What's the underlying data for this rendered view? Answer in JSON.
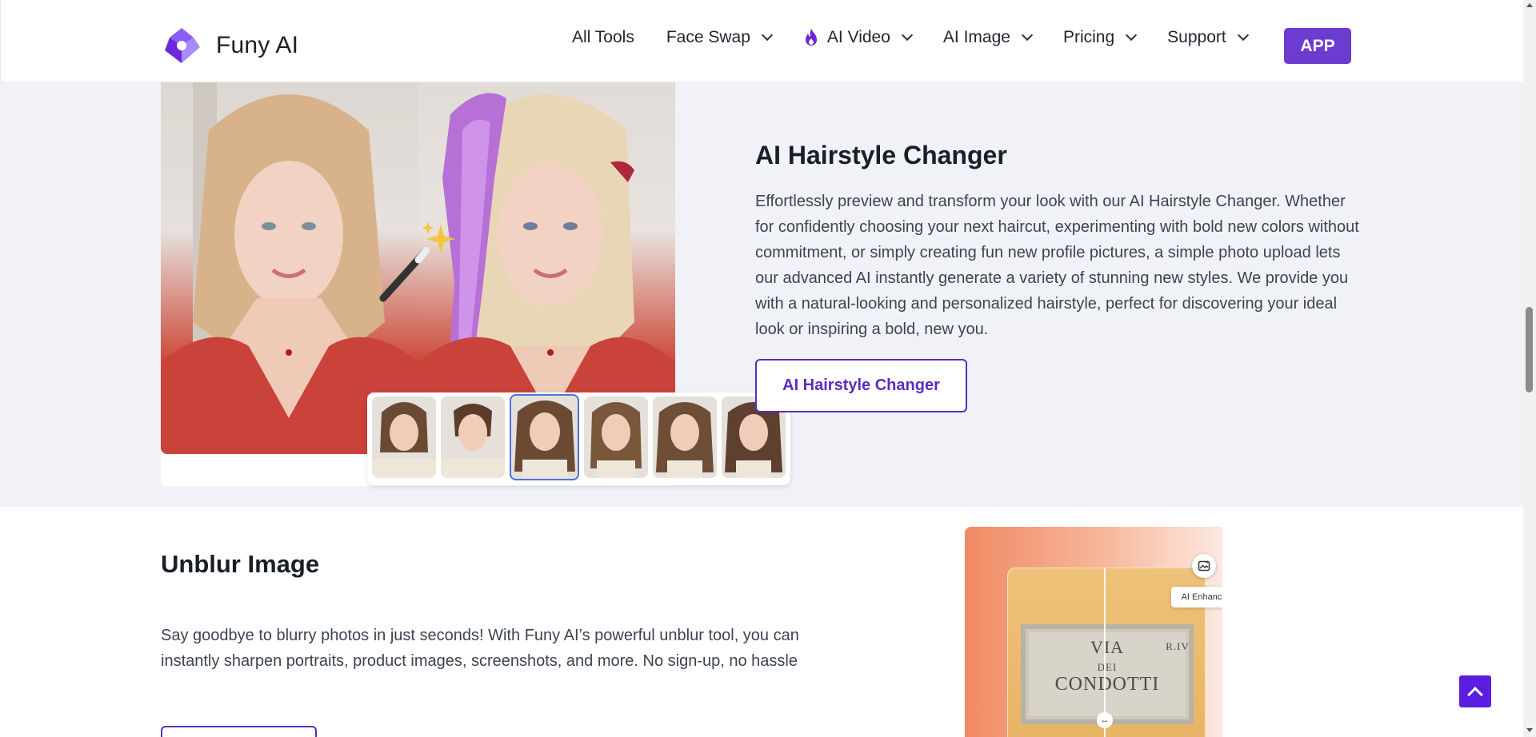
{
  "header": {
    "brand": "Funy AI",
    "nav": [
      {
        "label": "All Tools",
        "dropdown": false
      },
      {
        "label": "Face Swap",
        "dropdown": true
      },
      {
        "label": "AI Video",
        "dropdown": true,
        "icon": "fire-icon"
      },
      {
        "label": "AI Image",
        "dropdown": true
      },
      {
        "label": "Pricing",
        "dropdown": true
      },
      {
        "label": "Support",
        "dropdown": true
      }
    ],
    "app_button": "APP"
  },
  "hairstyle": {
    "title": "AI Hairstyle Changer",
    "description": "Effortlessly preview and transform your look with our AI Hairstyle Changer. Whether for confidently choosing your next haircut, experimenting with bold new colors without commitment, or simply creating fun new profile pictures, a simple photo upload lets our advanced AI instantly generate a variety of stunning new styles. We provide you with a natural-looking and personalized hairstyle, perfect for discovering your ideal look or inspiring a bold, new you.",
    "button": "AI Hairstyle Changer",
    "thumbnail_count": 6,
    "selected_thumbnail": 3
  },
  "unblur": {
    "title": "Unblur Image",
    "description": "Say goodbye to blurry photos in just seconds! With Funy AI’s powerful unblur tool, you can instantly sharpen portraits, product images, screenshots, and more. No sign-up, no hassle",
    "enhance_label": "AI Enhance",
    "plaque_lines": [
      "VIA",
      "DEI",
      "CONDOTTI",
      "R.IV"
    ]
  },
  "colors": {
    "accent": "#6c3bd0",
    "button_outline": "#5a2dbc",
    "back_to_top": "#5b1ee0",
    "section_bg": "#f0f2f7"
  }
}
